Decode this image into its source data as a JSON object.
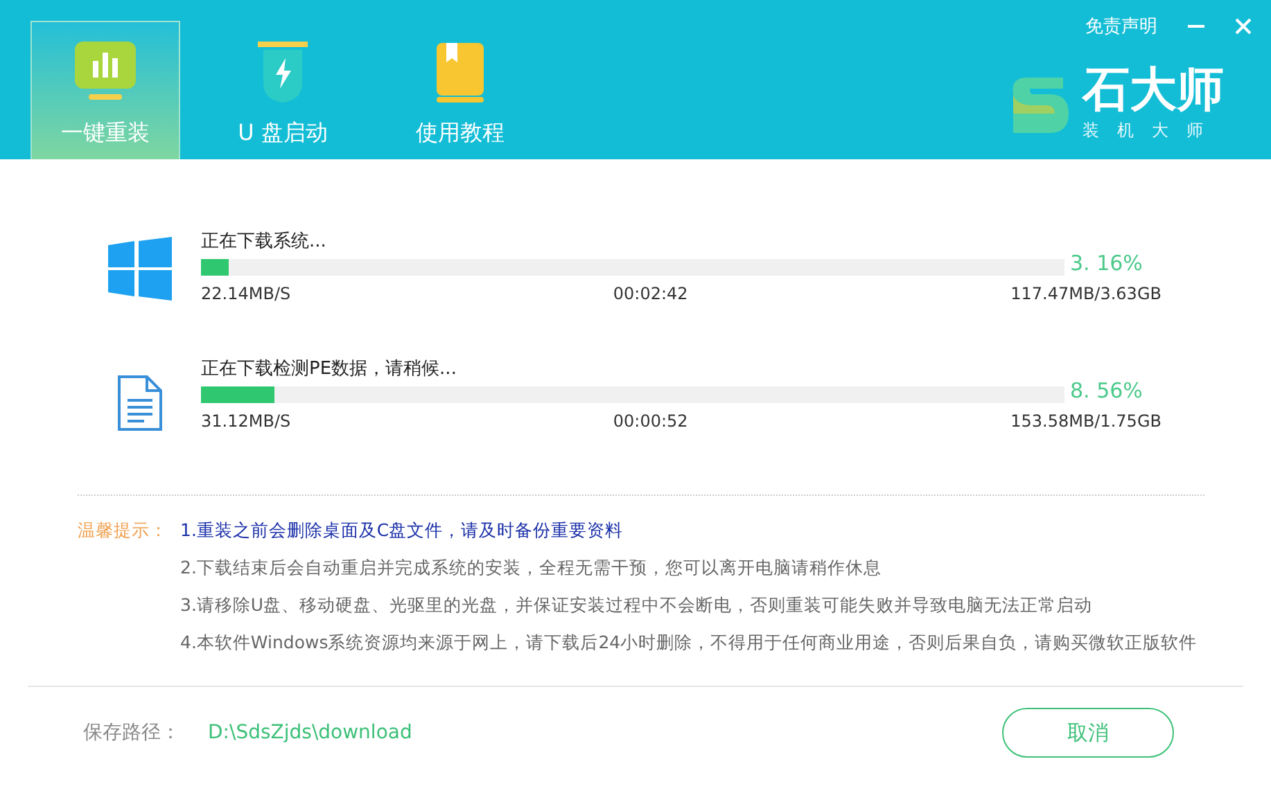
{
  "header": {
    "tabs": [
      {
        "label": "一键重装",
        "kind": "chart",
        "selected": true
      },
      {
        "label": "U 盘启动",
        "kind": "usb",
        "selected": false
      },
      {
        "label": "使用教程",
        "kind": "book",
        "selected": false
      }
    ],
    "disclaimer": "免责声明",
    "logo": {
      "name": "石大师",
      "subtitle": "装机大师"
    }
  },
  "downloads": [
    {
      "kind": "system",
      "title": "正在下载系统...",
      "level": 0.0316,
      "percent": "3. 16%",
      "speed": "22.14MB/S",
      "time": "00:02:42",
      "size": "117.47MB/3.63GB"
    },
    {
      "kind": "file",
      "title": "正在下载检测PE数据，请稍候...",
      "level": 0.0856,
      "percent": "8. 56%",
      "speed": "31.12MB/S",
      "time": "00:00:52",
      "size": "153.58MB/1.75GB"
    }
  ],
  "tips": {
    "label": "温馨提示：",
    "items": [
      {
        "text": "1.重装之前会删除桌面及C盘文件，请及时备份重要资料",
        "highlighted": true
      },
      {
        "text": "2.下载结束后会自动重启并完成系统的安装，全程无需干预，您可以离开电脑请稍作休息",
        "highlighted": false
      },
      {
        "text": "3.请移除U盘、移动硬盘、光驱里的光盘，并保证安装过程中不会断电，否则重装可能失败并导致电脑无法正常启动",
        "highlighted": false
      },
      {
        "text": "4.本软件Windows系统资源均来源于网上，请下载后24小时删除，不得用于任何商业用途，否则后果自负，请购买微软正版软件",
        "highlighted": false
      }
    ]
  },
  "footer": {
    "path_label": "保存路径：",
    "path": "D:\\SdsZjds\\download",
    "cancel": "取消"
  }
}
